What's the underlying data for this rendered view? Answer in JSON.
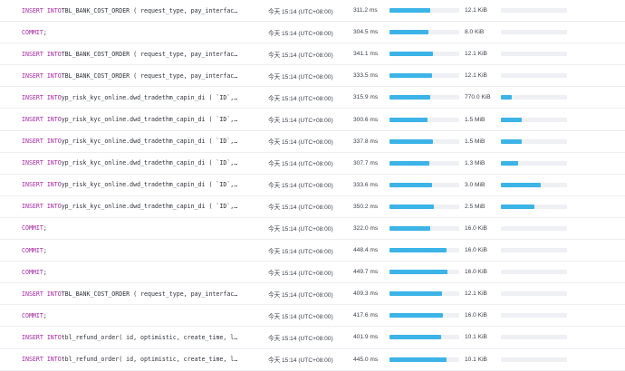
{
  "colors": {
    "keyword": "#a626a4",
    "bar_fill": "#3cb4e7",
    "bar_track": "#eef0f3"
  },
  "rows": [
    {
      "kw1": "INSERT",
      "kw2": "INTO",
      "rest": " TBL_BANK_COST_ORDER ( request_type, pay_interfac…",
      "time": "今天 15:14 (UTC+08:00)",
      "duration": "311.2 ms",
      "duration_fraction": 0.58,
      "size": "12.1 KiB",
      "size_fraction": 0.0
    },
    {
      "kw1": "COMMIT",
      "kw2": "",
      "rest": ";",
      "time": "今天 15:14 (UTC+08:00)",
      "duration": "304.5 ms",
      "duration_fraction": 0.56,
      "size": "8.0 KiB",
      "size_fraction": 0.0
    },
    {
      "kw1": "INSERT",
      "kw2": "INTO",
      "rest": " TBL_BANK_COST_ORDER ( request_type, pay_interfac…",
      "time": "今天 15:14 (UTC+08:00)",
      "duration": "341.1 ms",
      "duration_fraction": 0.62,
      "size": "12.1 KiB",
      "size_fraction": 0.0
    },
    {
      "kw1": "INSERT",
      "kw2": "INTO",
      "rest": " TBL_BANK_COST_ORDER ( request_type, pay_interfac…",
      "time": "今天 15:14 (UTC+08:00)",
      "duration": "333.5 ms",
      "duration_fraction": 0.61,
      "size": "12.1 KiB",
      "size_fraction": 0.0
    },
    {
      "kw1": "INSERT",
      "kw2": "INTO",
      "rest": " yp_risk_kyc_online.dwd_tradethm_capin_di ( `ID`,…",
      "time": "今天 15:14 (UTC+08:00)",
      "duration": "315.9 ms",
      "duration_fraction": 0.58,
      "size": "770.0 KiB",
      "size_fraction": 0.16
    },
    {
      "kw1": "INSERT",
      "kw2": "INTO",
      "rest": " yp_risk_kyc_online.dwd_tradethm_capin_di ( `ID`,…",
      "time": "今天 15:14 (UTC+08:00)",
      "duration": "300.6 ms",
      "duration_fraction": 0.55,
      "size": "1.5 MiB",
      "size_fraction": 0.31
    },
    {
      "kw1": "INSERT",
      "kw2": "INTO",
      "rest": " yp_risk_kyc_online.dwd_tradethm_capin_di ( `ID`,…",
      "time": "今天 15:14 (UTC+08:00)",
      "duration": "337.8 ms",
      "duration_fraction": 0.62,
      "size": "1.5 MiB",
      "size_fraction": 0.31
    },
    {
      "kw1": "INSERT",
      "kw2": "INTO",
      "rest": " yp_risk_kyc_online.dwd_tradethm_capin_di ( `ID`,…",
      "time": "今天 15:14 (UTC+08:00)",
      "duration": "307.7 ms",
      "duration_fraction": 0.57,
      "size": "1.3 MiB",
      "size_fraction": 0.26
    },
    {
      "kw1": "INSERT",
      "kw2": "INTO",
      "rest": " yp_risk_kyc_online.dwd_tradethm_capin_di ( `ID`,…",
      "time": "今天 15:14 (UTC+08:00)",
      "duration": "333.6 ms",
      "duration_fraction": 0.61,
      "size": "3.0 MiB",
      "size_fraction": 0.6
    },
    {
      "kw1": "INSERT",
      "kw2": "INTO",
      "rest": " yp_risk_kyc_online.dwd_tradethm_capin_di ( `ID`,…",
      "time": "今天 15:14 (UTC+08:00)",
      "duration": "350.2 ms",
      "duration_fraction": 0.64,
      "size": "2.5 MiB",
      "size_fraction": 0.5
    },
    {
      "kw1": "COMMIT",
      "kw2": "",
      "rest": ";",
      "time": "今天 15:14 (UTC+08:00)",
      "duration": "322.0 ms",
      "duration_fraction": 0.59,
      "size": "16.0 KiB",
      "size_fraction": 0.0
    },
    {
      "kw1": "COMMIT",
      "kw2": "",
      "rest": ";",
      "time": "今天 15:14 (UTC+08:00)",
      "duration": "448.4 ms",
      "duration_fraction": 0.82,
      "size": "16.0 KiB",
      "size_fraction": 0.0
    },
    {
      "kw1": "COMMIT",
      "kw2": "",
      "rest": ";",
      "time": "今天 15:14 (UTC+08:00)",
      "duration": "449.7 ms",
      "duration_fraction": 0.83,
      "size": "16.0 KiB",
      "size_fraction": 0.0
    },
    {
      "kw1": "INSERT",
      "kw2": "INTO",
      "rest": " TBL_BANK_COST_ORDER ( request_type, pay_interfac…",
      "time": "今天 15:14 (UTC+08:00)",
      "duration": "409.3 ms",
      "duration_fraction": 0.75,
      "size": "12.1 KiB",
      "size_fraction": 0.0
    },
    {
      "kw1": "COMMIT",
      "kw2": "",
      "rest": ";",
      "time": "今天 15:14 (UTC+08:00)",
      "duration": "417.6 ms",
      "duration_fraction": 0.77,
      "size": "16.0 KiB",
      "size_fraction": 0.0
    },
    {
      "kw1": "INSERT",
      "kw2": "INTO",
      "rest": " tbl_refund_order( id, optimistic, create_time, l…",
      "time": "今天 15:14 (UTC+08:00)",
      "duration": "401.9 ms",
      "duration_fraction": 0.74,
      "size": "10.1 KiB",
      "size_fraction": 0.0
    },
    {
      "kw1": "INSERT",
      "kw2": "INTO",
      "rest": " tbl_refund_order( id, optimistic, create_time, l…",
      "time": "今天 15:14 (UTC+08:00)",
      "duration": "445.0 ms",
      "duration_fraction": 0.82,
      "size": "10.1 KiB",
      "size_fraction": 0.0
    }
  ]
}
